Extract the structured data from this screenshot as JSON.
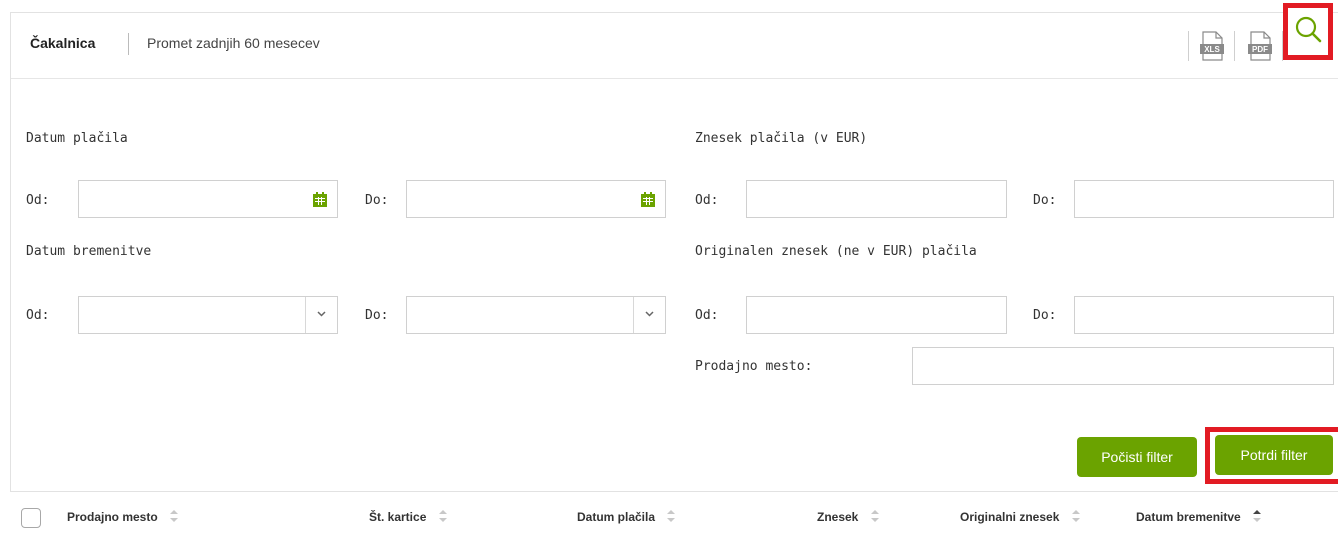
{
  "header": {
    "tabs": [
      {
        "label": "Čakalnica",
        "active": true
      },
      {
        "label": "Promet zadnjih 60 mesecev",
        "active": false
      }
    ],
    "icons": {
      "xls": "xls-export-icon",
      "pdf": "pdf-export-icon",
      "search": "search-icon"
    },
    "xls_text": "XLS",
    "pdf_text": "PDF"
  },
  "filters": {
    "payment_date": {
      "title": "Datum plačila",
      "from_label": "Od:",
      "to_label": "Do:",
      "from_value": "",
      "to_value": ""
    },
    "charge_date": {
      "title": "Datum bremenitve",
      "from_label": "Od:",
      "to_label": "Do:",
      "from_value": "",
      "to_value": ""
    },
    "amount_eur": {
      "title": "Znesek plačila (v EUR)",
      "from_label": "Od:",
      "to_label": "Do:",
      "from_value": "",
      "to_value": ""
    },
    "original_amount": {
      "title": "Originalen znesek (ne v EUR) plačila",
      "from_label": "Od:",
      "to_label": "Do:",
      "from_value": "",
      "to_value": ""
    },
    "point_of_sale": {
      "label": "Prodajno mesto:",
      "value": ""
    }
  },
  "buttons": {
    "clear": "Počisti filter",
    "confirm": "Potrdi filter"
  },
  "table": {
    "columns": [
      {
        "label": "Prodajno mesto",
        "sort": "none"
      },
      {
        "label": "Št. kartice",
        "sort": "none"
      },
      {
        "label": "Datum plačila",
        "sort": "none"
      },
      {
        "label": "Znesek",
        "sort": "none"
      },
      {
        "label": "Originalni znesek",
        "sort": "none"
      },
      {
        "label": "Datum bremenitve",
        "sort": "asc"
      }
    ]
  },
  "colors": {
    "accent_green": "#6ba300",
    "highlight_red": "#e21b23"
  }
}
